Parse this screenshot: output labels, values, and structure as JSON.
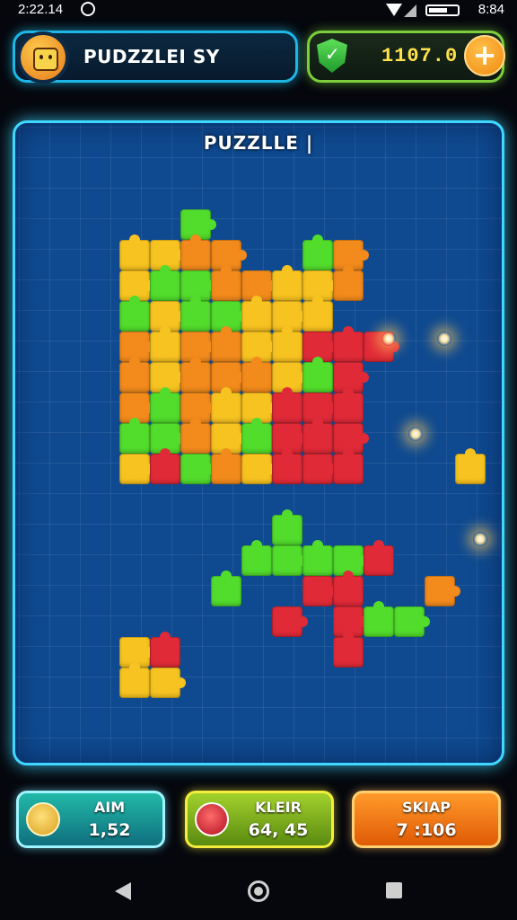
{
  "status_bar": {
    "time_left": "2:22.14",
    "time_right": "8:84"
  },
  "header": {
    "profile_name": "PUDZZLEI SY",
    "coins": "1107.0",
    "plus_label": "+"
  },
  "board": {
    "title": "PUZZLLE |"
  },
  "bottom_cards": [
    {
      "label": "AIM",
      "value": "1,52"
    },
    {
      "label": "KLEIR",
      "value": "64, 45"
    },
    {
      "label": "SKIAP",
      "value": "7 :106"
    }
  ],
  "colors": {
    "accent_cyan": "#3fd6ff",
    "board_blue": "#0f4a90",
    "piece_yellow": "#f7c320",
    "piece_orange": "#f28a1c",
    "piece_green": "#52dc2c",
    "piece_red": "#e12a38"
  },
  "icons": [
    "notification-icon",
    "wifi-icon",
    "signal-icon",
    "battery-icon",
    "avatar-icon",
    "shield-check-icon",
    "plus-icon",
    "aim-avatar-icon",
    "kleir-icon",
    "back-icon",
    "home-icon",
    "recent-apps-icon"
  ]
}
